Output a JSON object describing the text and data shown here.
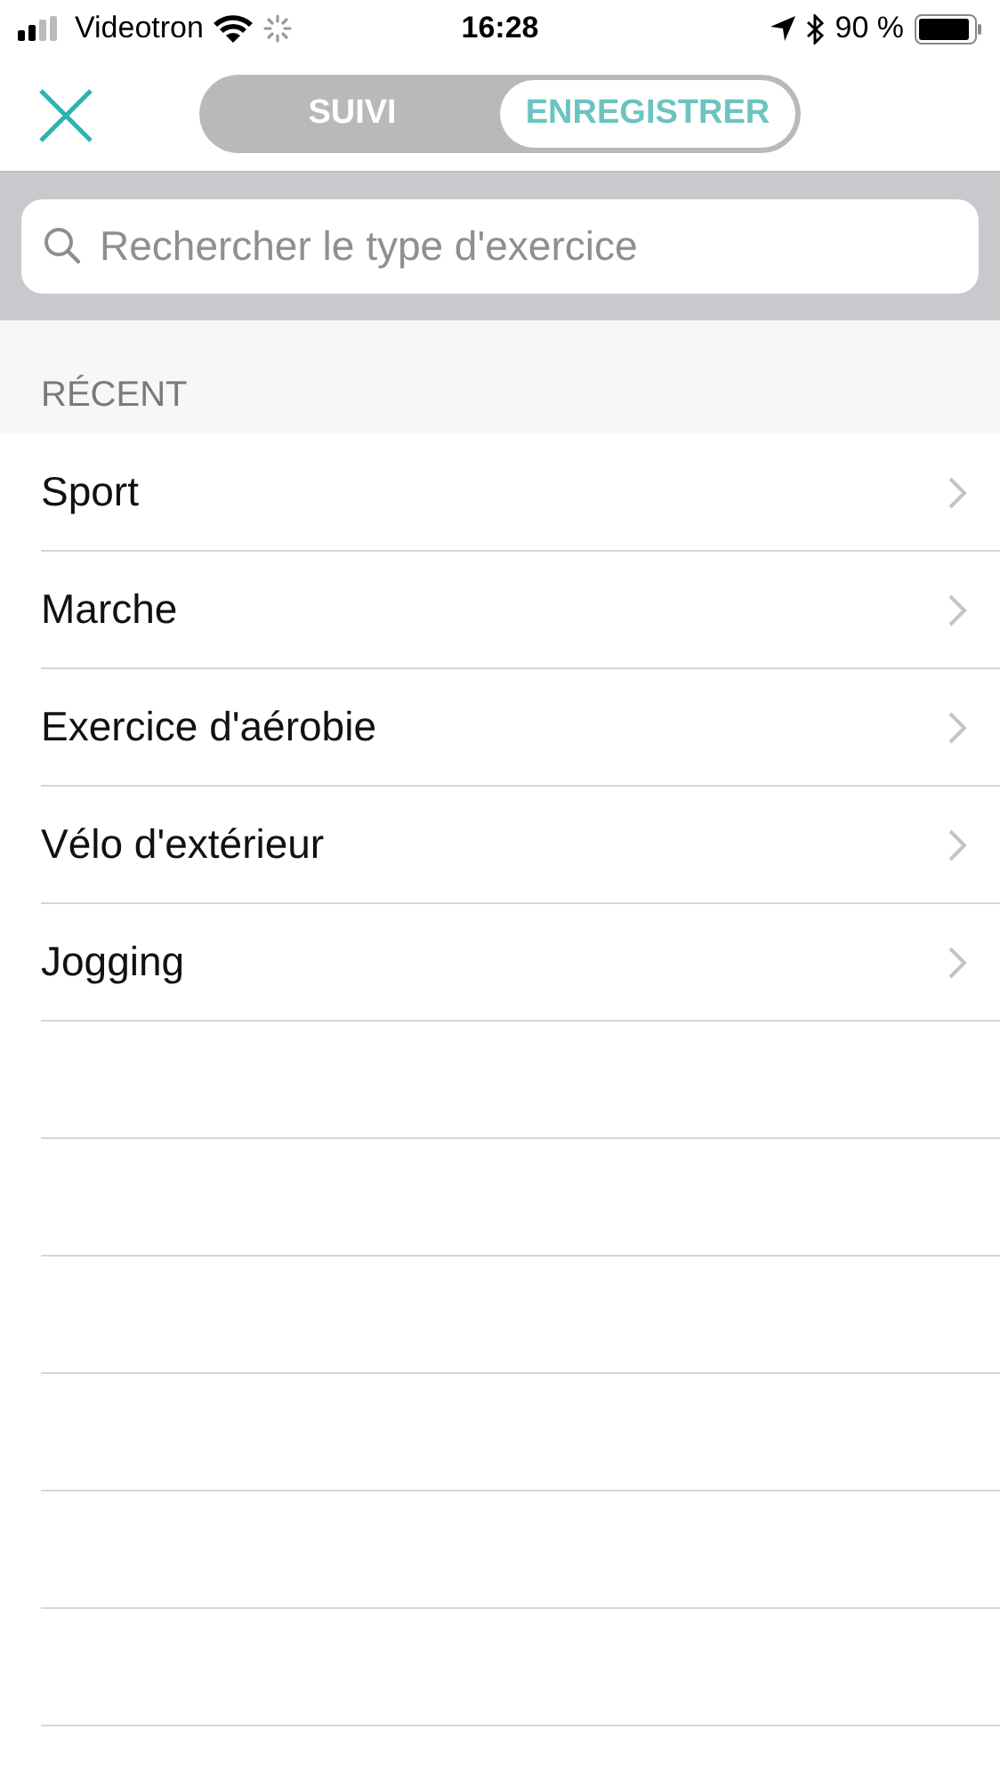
{
  "status_bar": {
    "carrier": "Videotron",
    "time": "16:28",
    "battery": "90 %"
  },
  "tabs": [
    {
      "label": "SUIVI",
      "selected": false
    },
    {
      "label": "ENREGISTRER",
      "selected": true
    }
  ],
  "search": {
    "placeholder": "Rechercher le type d'exercice"
  },
  "section": {
    "title": "RÉCENT"
  },
  "items": [
    {
      "label": "Sport"
    },
    {
      "label": "Marche"
    },
    {
      "label": "Exercice d'aérobie"
    },
    {
      "label": "Vélo d'extérieur"
    },
    {
      "label": "Jogging"
    }
  ]
}
